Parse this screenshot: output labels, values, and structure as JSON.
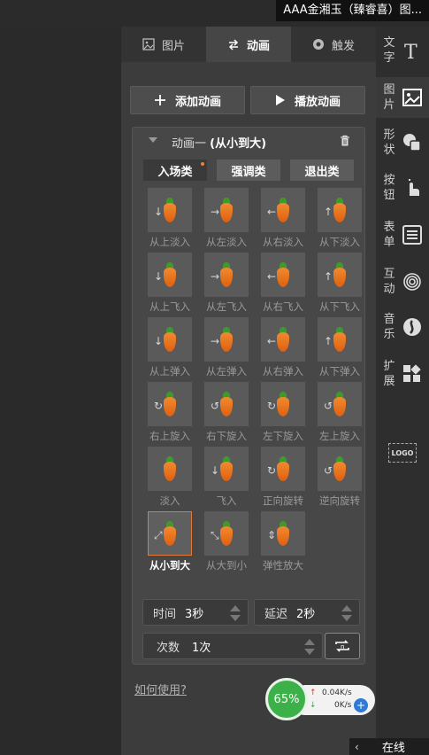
{
  "window": {
    "title": "AAA金湘玉（臻睿喜）图..."
  },
  "tabs": [
    {
      "label": "图片",
      "icon": "image-icon"
    },
    {
      "label": "动画",
      "icon": "swap-arrows-icon",
      "active": true
    },
    {
      "label": "触发",
      "icon": "target-icon"
    }
  ],
  "actions": {
    "add_label": "添加动画",
    "play_label": "播放动画"
  },
  "animation": {
    "title_prefix": "动画一 ",
    "title_name": "(从小到大)",
    "categories": [
      {
        "label": "入场类",
        "active": true
      },
      {
        "label": "强调类"
      },
      {
        "label": "退出类"
      }
    ],
    "effects": [
      "从上淡入",
      "从左淡入",
      "从右淡入",
      "从下淡入",
      "从上飞入",
      "从左飞入",
      "从右飞入",
      "从下飞入",
      "从上弹入",
      "从左弹入",
      "从右弹入",
      "从下弹入",
      "右上旋入",
      "右下旋入",
      "左下旋入",
      "左上旋入",
      "淡入",
      "飞入",
      "正向旋转",
      "逆向旋转",
      "从小到大",
      "从大到小",
      "弹性放大"
    ],
    "selected_effect": "从小到大",
    "time_label": "时间",
    "time_value": "3秒",
    "delay_label": "延迟",
    "delay_value": "2秒",
    "count_label": "次数",
    "count_value": "1次"
  },
  "help_link": "如何使用?",
  "network": {
    "percent": "65%",
    "up": "0.04K/s",
    "down": "0K/s",
    "up_arrow": "↑",
    "down_arrow": "↓"
  },
  "sidebar": [
    {
      "label": "文字",
      "icon": "text-icon"
    },
    {
      "label": "图片",
      "icon": "image-icon",
      "active": true
    },
    {
      "label": "形状",
      "icon": "shapes-icon"
    },
    {
      "label": "按钮",
      "icon": "hand-pointer-icon"
    },
    {
      "label": "表单",
      "icon": "list-form-icon"
    },
    {
      "label": "互动",
      "icon": "fingerprint-icon"
    },
    {
      "label": "音乐",
      "icon": "music-icon"
    },
    {
      "label": "扩展",
      "icon": "extension-icon"
    }
  ],
  "logo_label": "LOGO",
  "status": {
    "online": "在线"
  },
  "colors": {
    "accent": "#e07a3a",
    "panel": "#3c3c3c",
    "net_green": "#3cb14a"
  }
}
